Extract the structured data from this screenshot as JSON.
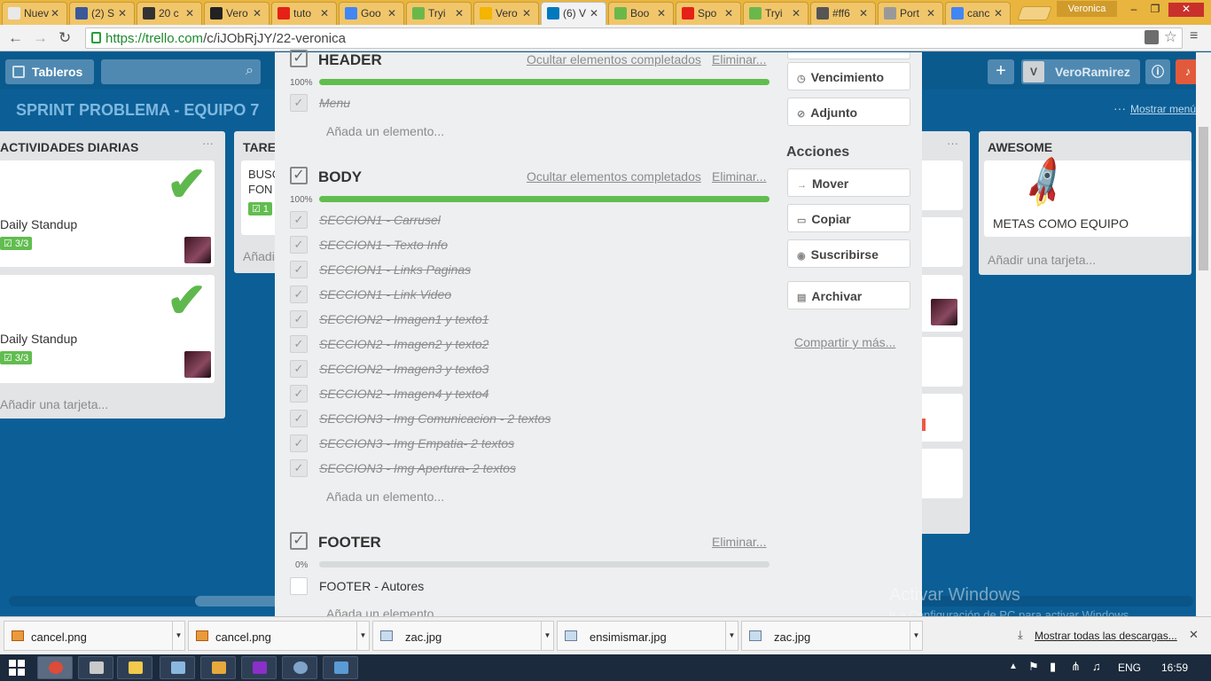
{
  "browser": {
    "tabs": [
      {
        "title": "Nueva p",
        "color": "#e9e9e9"
      },
      {
        "title": "(2) S",
        "color": "#3b5998"
      },
      {
        "title": "20 c",
        "color": "#333333"
      },
      {
        "title": "Vero",
        "color": "#222222"
      },
      {
        "title": "tuto",
        "color": "#e62117"
      },
      {
        "title": "Goo",
        "color": "#4285f4"
      },
      {
        "title": "Tryi",
        "color": "#6bb84a"
      },
      {
        "title": "Vero",
        "color": "#f4b400"
      },
      {
        "title": "(6) V",
        "color": "#0079bf"
      },
      {
        "title": "Boo",
        "color": "#6bb84a"
      },
      {
        "title": "Spo",
        "color": "#e62117"
      },
      {
        "title": "Tryi",
        "color": "#6bb84a"
      },
      {
        "title": "#ff6",
        "color": "#555555"
      },
      {
        "title": "Port",
        "color": "#999999"
      },
      {
        "title": "canc",
        "color": "#4285f4"
      }
    ],
    "user_badge": "Veronica",
    "url_scheme": "https://",
    "url_host": "trello.com",
    "url_path": "/c/iJObRjJY/22-veronica"
  },
  "trello": {
    "boards_button": "Tableros",
    "user_initial": "V",
    "user_name": "VeroRamirez",
    "board_title": "SPRINT PROBLEMA - EQUIPO 7",
    "show_menu": "Mostrar menú",
    "lists": {
      "left": {
        "title": "ACTIVIDADES DIARIAS",
        "cards": [
          {
            "title": "Daily Standup",
            "badge": "3/3"
          },
          {
            "title": "Daily Standup",
            "badge": "3/3"
          }
        ],
        "add_card": "Añadir una tarjeta..."
      },
      "second": {
        "title": "TARE",
        "card_line1": "BUSC",
        "card_line2": "FON",
        "badge": "1",
        "add_card": "Añadi"
      },
      "right": {
        "title": "AWESOME",
        "card_title": "METAS COMO EQUIPO",
        "add_card": "Añadir una tarjeta..."
      }
    }
  },
  "modal": {
    "header_section": {
      "title": "HEADER",
      "hide_link": "Ocultar elementos completados",
      "delete_link": "Eliminar...",
      "percent": "100%",
      "progress": 1.0,
      "items": [
        "Menu"
      ],
      "add_item": "Añada un elemento..."
    },
    "body_section": {
      "title": "BODY",
      "hide_link": "Ocultar elementos completados",
      "delete_link": "Eliminar...",
      "percent": "100%",
      "progress": 1.0,
      "items": [
        "SECCION1 - Carrusel",
        "SECCION1 - Texto Info",
        "SECCION1 - Links Paginas",
        "SECCION1 - Link Video",
        "SECCION2 - Imagen1 y texto1",
        "SECCION2 - Imagen2 y texto2",
        "SECCION2 - Imagen3 y texto3",
        "SECCION2 - Imagen4 y texto4",
        "SECCION3 - Img Comunicacion - 2 textos",
        "SECCION3 - Img Empatia- 2 textos",
        "SECCION3 - Img Apertura- 2 textos"
      ],
      "add_item": "Añada un elemento..."
    },
    "footer_section": {
      "title": "FOOTER",
      "delete_link": "Eliminar...",
      "percent": "0%",
      "progress": 0.0,
      "items": [
        "FOOTER - Autores"
      ],
      "add_item": "Añada un elemento..."
    },
    "sidebar": {
      "due": "Vencimiento",
      "attachment": "Adjunto",
      "actions_heading": "Acciones",
      "move": "Mover",
      "copy": "Copiar",
      "subscribe": "Suscribirse",
      "archive": "Archivar",
      "share": "Compartir y más..."
    }
  },
  "windows_watermark": {
    "line1": "Activar Windows",
    "line2": "Ir a Configuración de PC para activar Windows."
  },
  "downloads": {
    "files": [
      "cancel.png",
      "cancel.png",
      "zac.jpg",
      "ensimismar.jpg",
      "zac.jpg"
    ],
    "show_all": "Mostrar todas las descargas..."
  },
  "taskbar": {
    "lang": "ENG",
    "time": "16:59"
  }
}
